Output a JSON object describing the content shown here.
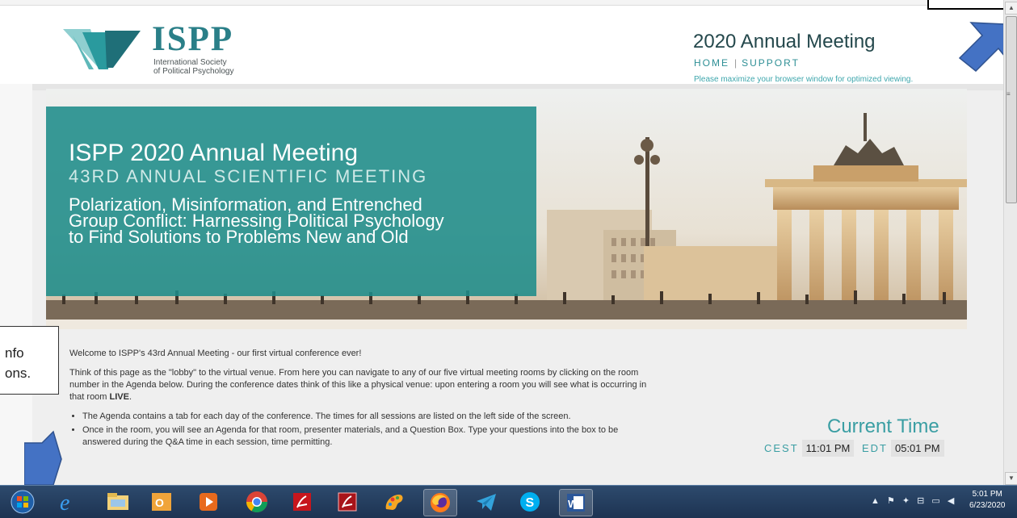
{
  "header": {
    "logo_title": "ISPP",
    "logo_sub_1": "International Society",
    "logo_sub_2": "of Political Psychology",
    "meeting_title": "2020 Annual Meeting",
    "nav": [
      "HOME",
      "SUPPORT"
    ],
    "nav_separator": "|",
    "maximize_note": "Please maximize your browser window for optimized viewing."
  },
  "banner": {
    "title": "ISPP 2020 Annual Meeting",
    "subtitle": "43RD ANNUAL SCIENTIFIC MEETING",
    "theme_line_1": "Polarization, Misinformation, and Entrenched",
    "theme_line_2": "Group Conflict: Harnessing Political Psychology",
    "theme_line_3": "to Find Solutions to Problems New and Old"
  },
  "content": {
    "welcome": "Welcome to ISPP's 43rd Annual Meeting - our first virtual conference ever!",
    "lobby_text": "Think of this page as the \"lobby\" to the virtual venue. From here you can navigate to any of our five virtual meeting rooms by clicking on the room number in the Agenda below. During the conference dates think of this like a physical venue: upon entering a room you will see what is occurring in that room ",
    "lobby_live": "LIVE",
    "lobby_end": ".",
    "bullets": [
      "The Agenda contains a tab for each day of the conference. The times for all sessions are listed on the left side of the screen.",
      "Once in the room, you will see an Agenda for that room, presenter materials, and a Question Box. Type your questions into the box to be answered during the Q&A time in each session, time permitting."
    ]
  },
  "current_time": {
    "title": "Current Time",
    "zone1": "CEST",
    "time1": "11:01 PM",
    "zone2": "EDT",
    "time2": "05:01 PM"
  },
  "annotation": {
    "line1": "nfo",
    "line2": "ons."
  },
  "taskbar": {
    "icons": [
      "windows-start-icon",
      "internet-explorer-icon",
      "file-explorer-icon",
      "outlook-icon",
      "media-player-icon",
      "chrome-icon",
      "acrobat-icon",
      "acrobat-reader-icon",
      "paint-icon",
      "firefox-icon",
      "telegram-icon",
      "skype-icon",
      "word-icon"
    ],
    "tray_icons": "▲ ⚑ ✦ ⊟ ▭ ◀",
    "clock_time": "5:01 PM",
    "clock_date": "6/23/2020"
  },
  "colors": {
    "teal": "#2a8f93",
    "arrow_blue": "#4472c4"
  }
}
